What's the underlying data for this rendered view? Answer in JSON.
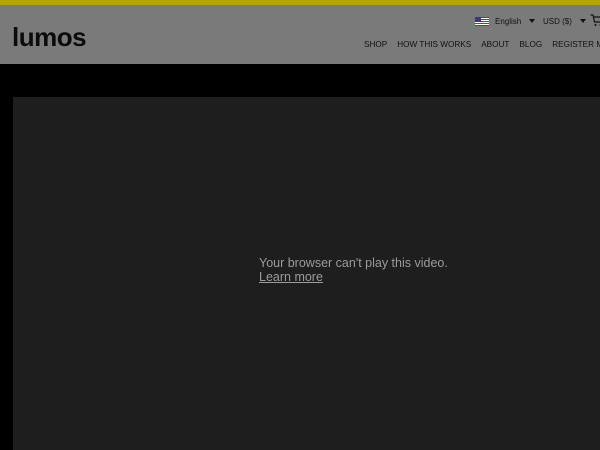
{
  "theme": {
    "top_strip_color": "#b6a400",
    "header_bg": "#7a7a7a",
    "page_bg": "#000000",
    "video_bg": "#1e1e1e",
    "video_text_color": "#9b9b9b",
    "header_text_color": "#111111"
  },
  "brand": {
    "logo_text": "lumos"
  },
  "header": {
    "language": {
      "label": "English",
      "flag_icon": "us-flag-icon"
    },
    "currency": {
      "label": "USD ($)"
    },
    "nav": [
      {
        "label": "SHOP"
      },
      {
        "label": "HOW THIS WORKS"
      },
      {
        "label": "ABOUT"
      },
      {
        "label": "BLOG"
      },
      {
        "label": "REGISTER MY I"
      }
    ],
    "cart_icon": "cart-icon"
  },
  "video": {
    "message_line1": "Your browser can't play this video.",
    "link_label": "Learn more"
  }
}
